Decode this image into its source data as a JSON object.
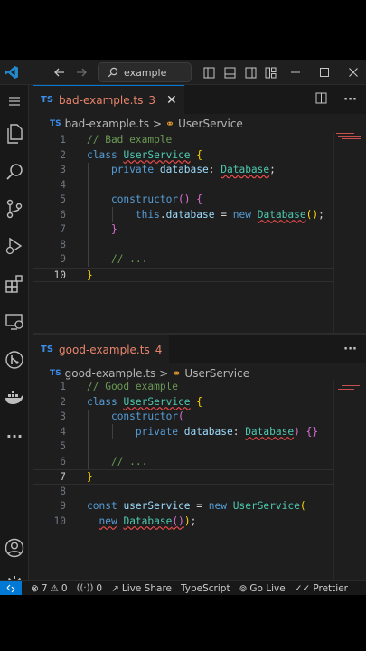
{
  "titlebar": {
    "search_placeholder": "example"
  },
  "top": {
    "tab": {
      "lang": "TS",
      "name": "bad-example.ts",
      "problems": "3",
      "close": "✕"
    },
    "breadcrumb": {
      "lang": "TS",
      "file": "bad-example.ts",
      "separator": ">",
      "symbol": "UserService"
    },
    "lines": [
      "1",
      "2",
      "3",
      "4",
      "5",
      "6",
      "7",
      "8",
      "9",
      "10"
    ]
  },
  "bottom": {
    "tab": {
      "lang": "TS",
      "name": "good-example.ts",
      "problems": "4",
      "more": "···"
    },
    "breadcrumb": {
      "lang": "TS",
      "file": "good-example.ts",
      "separator": ">",
      "symbol": "UserService"
    },
    "lines": [
      "1",
      "2",
      "3",
      "4",
      "5",
      "6",
      "7",
      "8",
      "9",
      "10"
    ]
  },
  "statusbar": {
    "errors": "7",
    "warnings": "0",
    "ports": "0",
    "live_share": "Live Share",
    "language": "TypeScript",
    "go_live": "Go Live",
    "prettier": "Prettier"
  },
  "colors": {
    "accent": "#0078d4",
    "error": "#f14c4c",
    "tab_modified": "#e8846b"
  }
}
